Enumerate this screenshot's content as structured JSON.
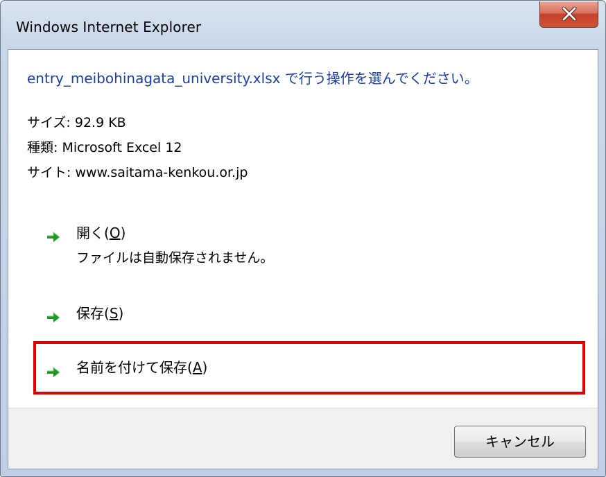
{
  "window": {
    "title": "Windows Internet Explorer"
  },
  "dialog": {
    "heading": "entry_meibohinagata_university.xlsx で行う操作を選んでください。",
    "size": "サイズ: 92.9 KB",
    "type": "種類: Microsoft Excel 12",
    "site": "サイト: www.saitama-kenkou.or.jp",
    "commands": {
      "open": {
        "label": "開く(",
        "accel": "O",
        "close": ")",
        "note": "ファイルは自動保存されません。"
      },
      "save": {
        "label": "保存(",
        "accel": "S",
        "close": ")"
      },
      "save_as": {
        "label": "名前を付けて保存(",
        "accel": "A",
        "close": ")"
      }
    },
    "cancel_label": "キャンセル"
  },
  "colors": {
    "heading": "#1a3ea8",
    "arrow": "#1f9a1f",
    "highlight": "#e00000"
  },
  "icons": {
    "close": "close-icon",
    "arrow": "green-arrow-icon"
  }
}
